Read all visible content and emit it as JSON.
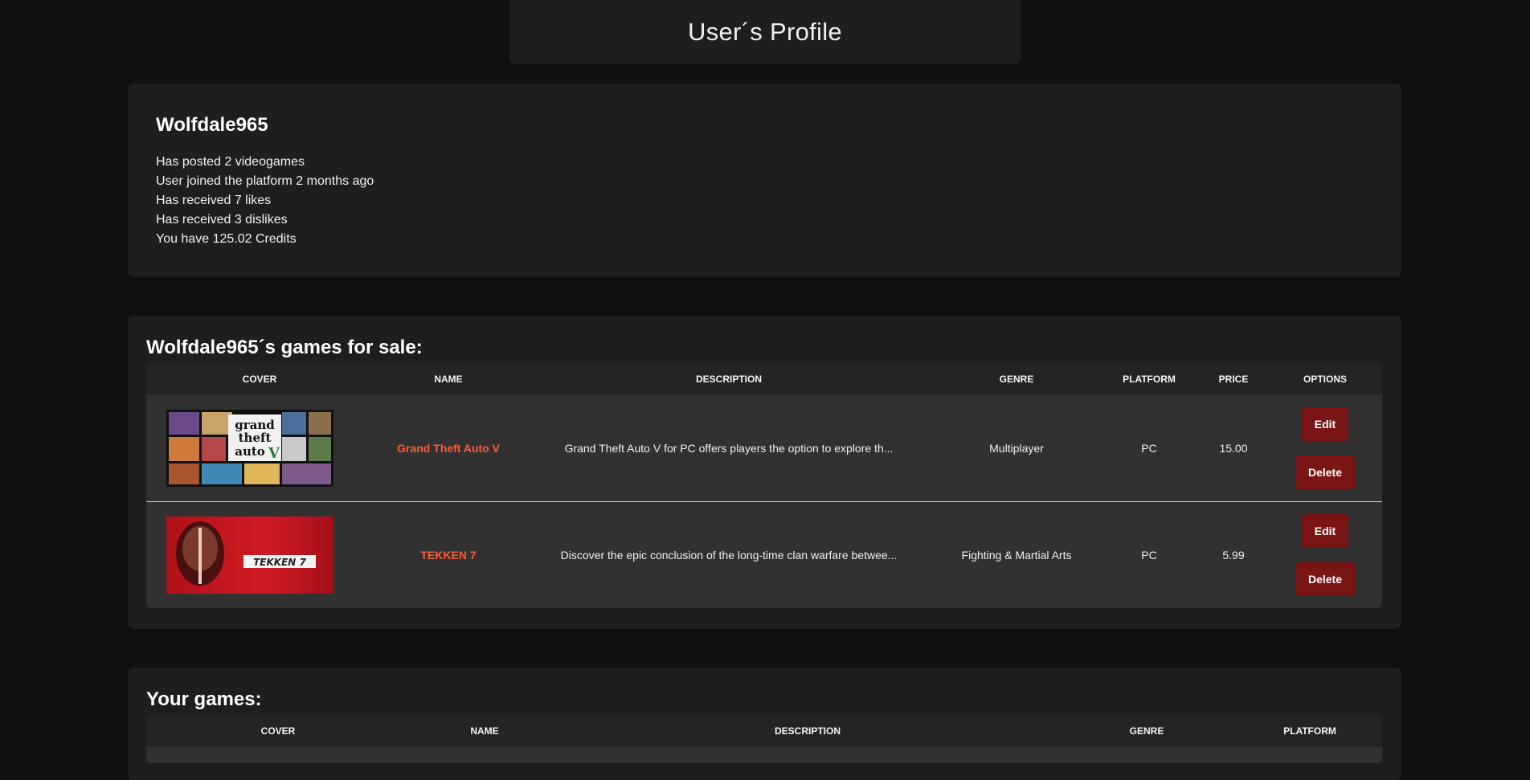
{
  "header": {
    "title": "User´s Profile"
  },
  "profile": {
    "username": "Wolfdale965",
    "stats": [
      "Has posted 2 videogames",
      "User joined the platform 2 months ago",
      "Has received 7 likes",
      "Has received 3 dislikes",
      "You have 125.02 Credits"
    ]
  },
  "sale": {
    "title": "Wolfdale965´s games for sale:",
    "columns": {
      "cover": "COVER",
      "name": "NAME",
      "description": "DESCRIPTION",
      "genre": "GENRE",
      "platform": "PLATFORM",
      "price": "PRICE",
      "options": "OPTIONS"
    },
    "rows": [
      {
        "name": "Grand Theft Auto V",
        "description": "Grand Theft Auto V for PC offers players the option to explore th...",
        "genre": "Multiplayer",
        "platform": "PC",
        "price": "15.00",
        "edit": "Edit",
        "delete": "Delete",
        "cover_logo": [
          "grand",
          "theft",
          "auto",
          "V"
        ]
      },
      {
        "name": "TEKKEN 7",
        "description": "Discover the epic conclusion of the long-time clan warfare betwee...",
        "genre": "Fighting & Martial Arts",
        "platform": "PC",
        "price": "5.99",
        "edit": "Edit",
        "delete": "Delete",
        "cover_logo": "TEKKEN 7"
      }
    ]
  },
  "your_games": {
    "title": "Your games:",
    "columns": {
      "cover": "COVER",
      "name": "NAME",
      "description": "DESCRIPTION",
      "genre": "GENRE",
      "platform": "PLATFORM"
    }
  },
  "colors": {
    "background": "#101010",
    "card": "#1f1e1e",
    "table_row": "#323131",
    "accent_name": "#ff5a36",
    "button": "#7a1515"
  }
}
